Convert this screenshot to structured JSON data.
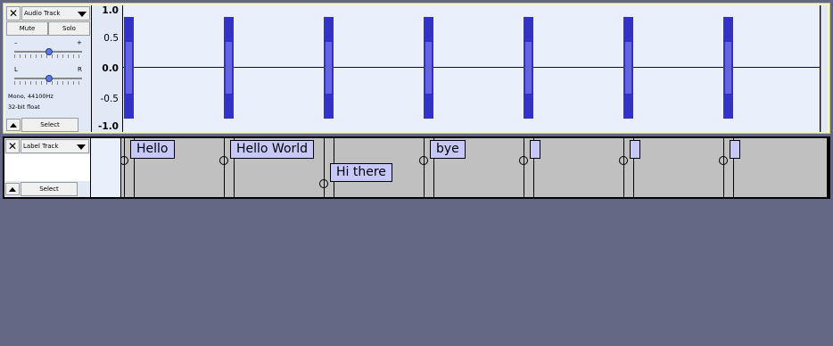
{
  "audio_track": {
    "name": "Audio Track",
    "close_glyph": "✕",
    "mute_label": "Mute",
    "solo_label": "Solo",
    "gain_minus": "–",
    "gain_plus": "+",
    "pan_left": "L",
    "pan_right": "R",
    "format_line1": "Mono, 44100Hz",
    "format_line2": "32-bit float",
    "select_label": "Select",
    "ruler": [
      "1.0",
      "0.5",
      "0.0",
      "-0.5",
      "-1.0"
    ]
  },
  "label_track": {
    "name": "Label Track",
    "close_glyph": "✕",
    "select_label": "Select",
    "labels": [
      "Hello",
      "Hello World",
      "Hi there",
      "bye",
      "",
      "",
      ""
    ]
  },
  "colors": {
    "background": "#636784",
    "waveform": "#3232c8",
    "waveform_rms": "#6464dc",
    "label_fill": "#c8c8f8"
  },
  "icons": [
    "close-icon",
    "dropdown-arrow-icon",
    "collapse-arrow-icon",
    "slider-thumb-icon"
  ]
}
